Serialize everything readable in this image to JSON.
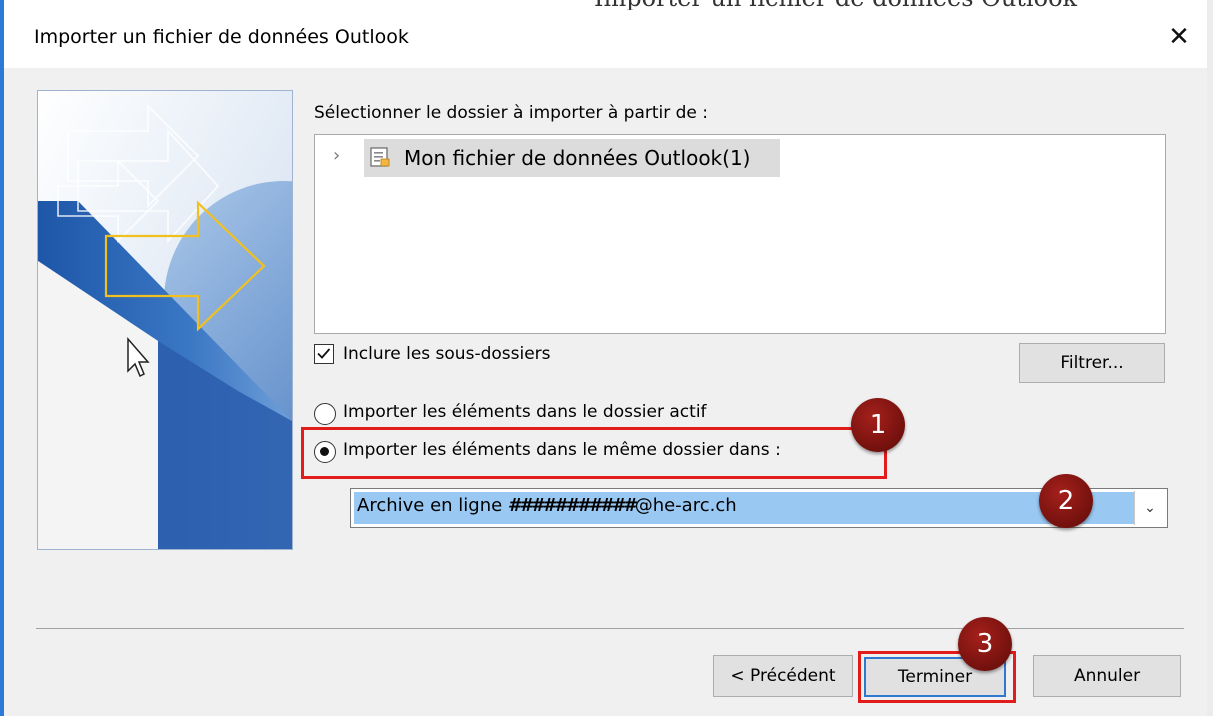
{
  "window": {
    "top_strip_text": "Importer un fichier de données Outlook",
    "title": "Importer un fichier de données Outlook",
    "close_glyph": "✕"
  },
  "folder_section": {
    "label": "Sélectionner le dossier à importer à partir de :",
    "tree": [
      {
        "label": "Mon fichier de données Outlook(1)",
        "expander": "›",
        "icon": "outlook-data-file-icon",
        "selected": true
      }
    ]
  },
  "include_subfolders": {
    "label": "Inclure les sous-dossiers",
    "checked": true
  },
  "filter_button": "Filtrer...",
  "import_options": [
    {
      "label": "Importer les éléments dans le dossier actif",
      "selected": false
    },
    {
      "label": "Importer les éléments dans le même dossier dans :",
      "selected": true
    }
  ],
  "target_dropdown": {
    "value_prefix": "Archive en ligne ",
    "value_redacted": "###########",
    "value_suffix": "@he-arc.ch",
    "arrow": "⌄"
  },
  "buttons": {
    "previous": "< Précédent",
    "finish": "Terminer",
    "cancel": "Annuler"
  },
  "annotations": [
    "1",
    "2",
    "3"
  ],
  "colors": {
    "accent": "#2b79d8",
    "annotation_red": "#e21b1b",
    "badge": "#8b1a15",
    "selection": "#99c8f2",
    "illustration_blue": "#2a64b3",
    "arrow_outline": "#f0c020"
  }
}
